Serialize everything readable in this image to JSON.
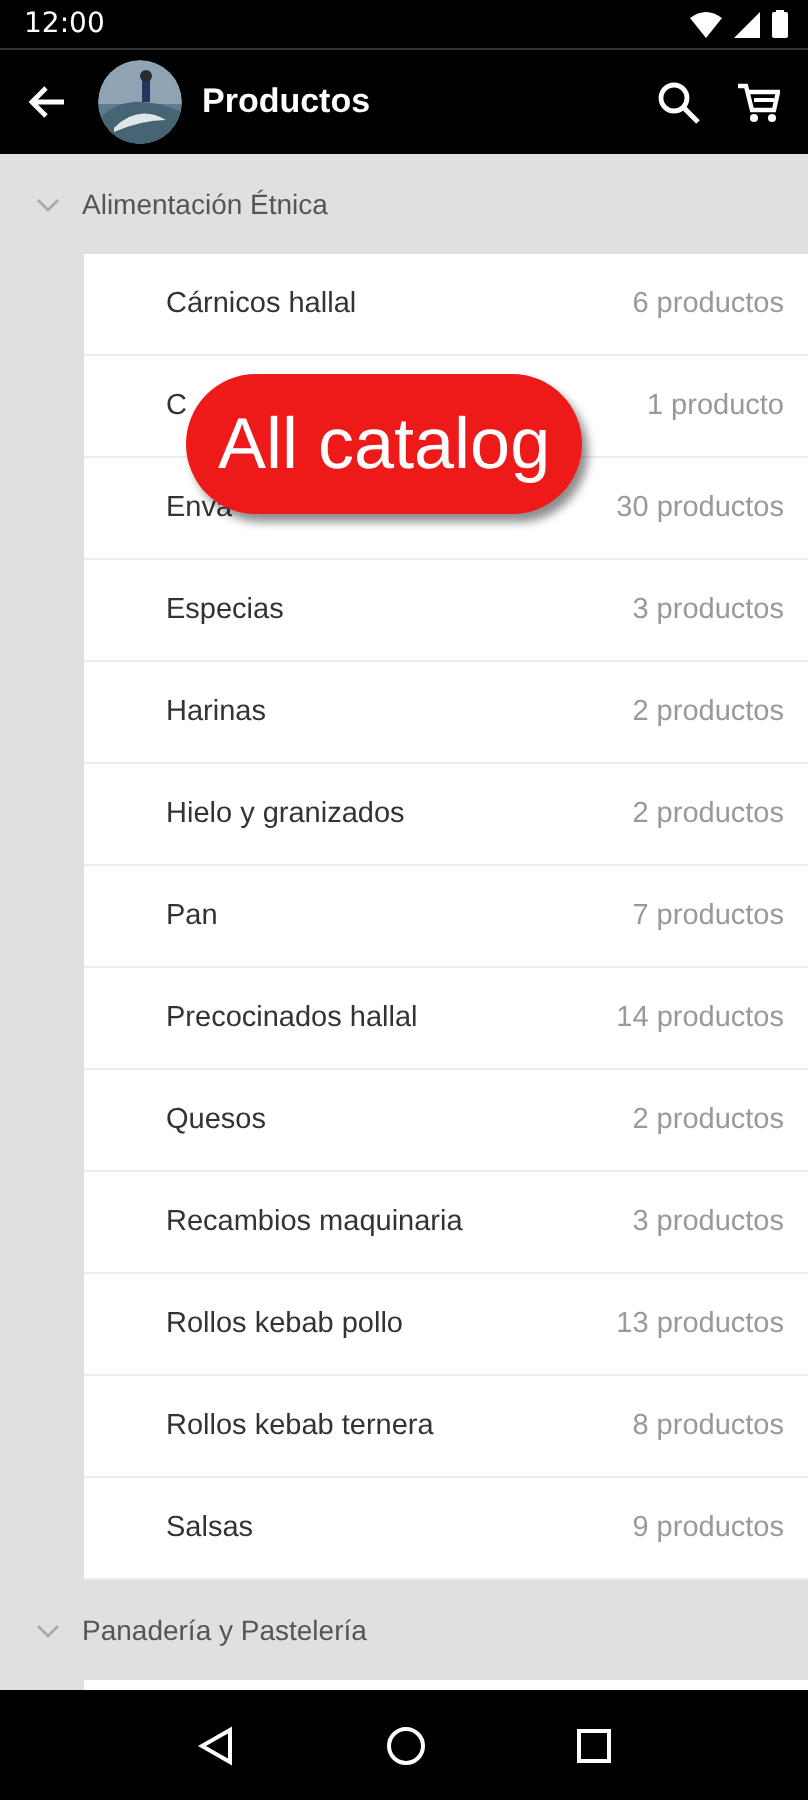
{
  "status_bar": {
    "time": "12:00"
  },
  "app_bar": {
    "title": "Productos"
  },
  "sections": [
    {
      "title": "Alimentación Étnica",
      "expanded": true,
      "items": [
        {
          "name": "Cárnicos hallal",
          "count": "6 productos"
        },
        {
          "name": "C",
          "count": "1 producto"
        },
        {
          "name": "Enva",
          "count": "30 productos"
        },
        {
          "name": "Especias",
          "count": "3 productos"
        },
        {
          "name": "Harinas",
          "count": "2 productos"
        },
        {
          "name": "Hielo y granizados",
          "count": "2 productos"
        },
        {
          "name": "Pan",
          "count": "7 productos"
        },
        {
          "name": "Precocinados hallal",
          "count": "14 productos"
        },
        {
          "name": "Quesos",
          "count": "2 productos"
        },
        {
          "name": "Recambios maquinaria",
          "count": "3 productos"
        },
        {
          "name": "Rollos kebab pollo",
          "count": "13 productos"
        },
        {
          "name": "Rollos kebab ternera",
          "count": "8 productos"
        },
        {
          "name": "Salsas",
          "count": "9 productos"
        }
      ]
    },
    {
      "title": "Panadería y Pastelería",
      "expanded": true
    }
  ],
  "overlay_badge": {
    "text": "All catalog"
  }
}
